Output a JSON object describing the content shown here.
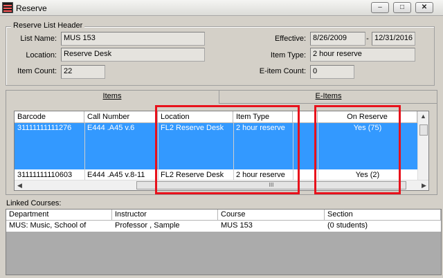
{
  "window": {
    "title": "Reserve"
  },
  "window_controls": [
    "–",
    "□",
    "✕"
  ],
  "header_group": {
    "legend": "Reserve List Header",
    "list_name_label": "List Name:",
    "list_name_value": "MUS 153",
    "location_label": "Location:",
    "location_value": "Reserve Desk",
    "item_count_label": "Item Count:",
    "item_count_value": "22",
    "effective_label": "Effective:",
    "effective_start": "8/26/2009",
    "effective_sep": "-",
    "effective_end": "12/31/2016",
    "item_type_label": "Item Type:",
    "item_type_value": "2 hour reserve",
    "eitem_count_label": "E-item Count:",
    "eitem_count_value": "0"
  },
  "tabs": [
    {
      "label": "Items",
      "active": true
    },
    {
      "label": "E-Items",
      "active": false
    }
  ],
  "items_grid": {
    "columns": [
      "Barcode",
      "Call Number",
      "Location",
      "Item Type",
      "",
      "On Reserve"
    ],
    "rows": [
      {
        "barcode": "31111111111276",
        "call_number": "E444 .A45 v.6",
        "location": "FL2 Reserve Desk",
        "item_type": "2 hour reserve",
        "on_reserve": "Yes (75)",
        "selected": true
      },
      {
        "barcode": "31111111110603",
        "call_number": "E444 .A45 v.8-11",
        "location": "FL2 Reserve Desk",
        "item_type": "2 hour reserve",
        "on_reserve": "Yes (2)",
        "selected": false
      }
    ],
    "scroll_thumb_grip": "III"
  },
  "linked_courses": {
    "label": "Linked Courses:",
    "columns": [
      "Department",
      "Instructor",
      "Course",
      "Section"
    ],
    "rows": [
      {
        "department": "MUS: Music, School of",
        "instructor": "Professor , Sample",
        "course": "MUS 153",
        "section": "(0 students)"
      }
    ]
  },
  "colors": {
    "selection": "#3399ff",
    "highlight_box": "#e8111b",
    "window_bg": "#d4d0c8"
  }
}
